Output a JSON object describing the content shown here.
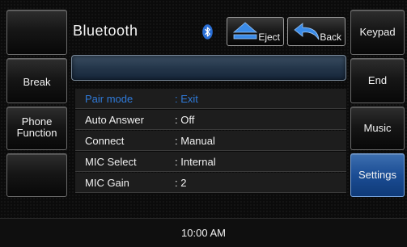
{
  "header": {
    "title": "Bluetooth",
    "icon": "bluetooth-icon"
  },
  "top_buttons": {
    "eject": "Eject",
    "back": "Back"
  },
  "left_buttons": [
    "",
    "Break",
    "Phone\nFunction",
    ""
  ],
  "right_buttons": [
    "Keypad",
    "End",
    "Music",
    "Settings"
  ],
  "menu": [
    {
      "key": "Pair mode",
      "value": "Exit",
      "highlight": true
    },
    {
      "key": "Auto Answer",
      "value": "Off"
    },
    {
      "key": "Connect",
      "value": "Manual"
    },
    {
      "key": "MIC Select",
      "value": "Internal"
    },
    {
      "key": "MIC Gain",
      "value": "2"
    }
  ],
  "status": {
    "time": "10:00 AM"
  },
  "colors": {
    "accent": "#1b4d94",
    "highlight_text": "#2f7ad9"
  }
}
